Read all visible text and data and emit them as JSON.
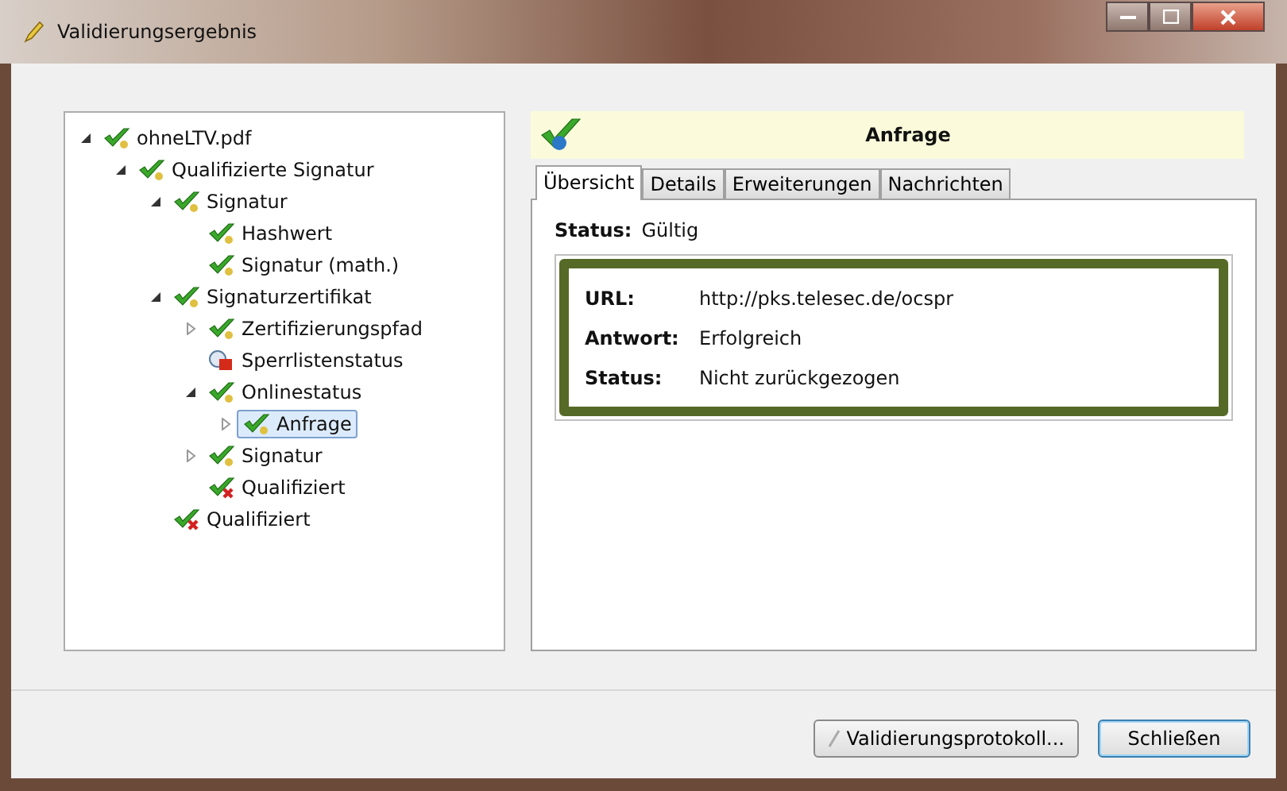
{
  "window": {
    "title": "Validierungsergebnis"
  },
  "tree": [
    {
      "label": "ohneLTV.pdf",
      "kind": "ok",
      "selected": false,
      "expanded": true,
      "children": [
        {
          "label": "Qualifizierte Signatur",
          "kind": "ok",
          "selected": false,
          "expanded": true,
          "children": [
            {
              "label": "Signatur",
              "kind": "ok",
              "selected": false,
              "expanded": true,
              "children": [
                {
                  "label": "Hashwert",
                  "kind": "ok",
                  "selected": false
                },
                {
                  "label": "Signatur (math.)",
                  "kind": "ok",
                  "selected": false
                }
              ]
            },
            {
              "label": "Signaturzertifikat",
              "kind": "ok",
              "selected": false,
              "expanded": true,
              "children": [
                {
                  "label": "Zertifizierungspfad",
                  "kind": "ok",
                  "selected": false,
                  "expanded": false
                },
                {
                  "label": "Sperrlistenstatus",
                  "kind": "info",
                  "selected": false
                },
                {
                  "label": "Onlinestatus",
                  "kind": "ok",
                  "selected": false,
                  "expanded": true,
                  "children": [
                    {
                      "label": "Anfrage",
                      "kind": "ok",
                      "selected": true,
                      "expanded": false
                    }
                  ]
                },
                {
                  "label": "Signatur",
                  "kind": "ok",
                  "selected": false,
                  "expanded": false
                },
                {
                  "label": "Qualifiziert",
                  "kind": "warn",
                  "selected": false
                }
              ]
            },
            {
              "label": "Qualifiziert",
              "kind": "warn",
              "selected": false
            }
          ]
        }
      ]
    }
  ],
  "detail": {
    "title": "Anfrage",
    "tabs": [
      {
        "label": "Übersicht",
        "selected": true
      },
      {
        "label": "Details",
        "selected": false
      },
      {
        "label": "Erweiterungen",
        "selected": false
      },
      {
        "label": "Nachrichten",
        "selected": false
      }
    ],
    "status": {
      "label": "Status:",
      "value": "Gültig"
    },
    "fields": [
      {
        "label": "URL:",
        "value": "http://pks.telesec.de/ocspr"
      },
      {
        "label": "Antwort:",
        "value": "Erfolgreich"
      },
      {
        "label": "Status:",
        "value": "Nicht zurückgezogen"
      }
    ]
  },
  "buttons": [
    {
      "label": "Validierungsprotokoll...",
      "kind": "icon"
    },
    {
      "label": "Schließen",
      "kind": "default"
    }
  ]
}
